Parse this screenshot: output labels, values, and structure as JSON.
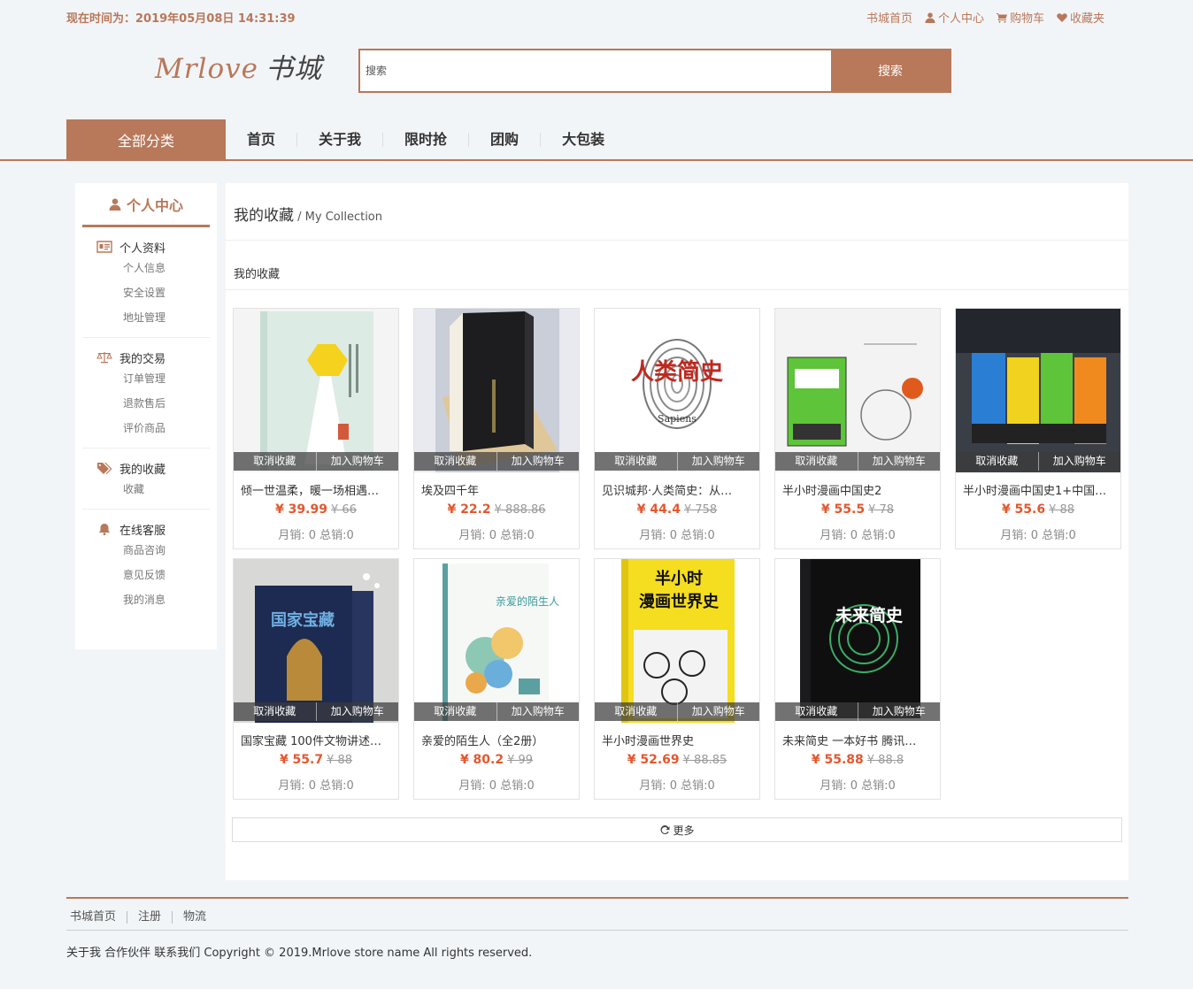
{
  "topbar": {
    "time_label": "现在时间为：2019年05月08日 14:31:39",
    "links": [
      {
        "label": "书城首页",
        "icon": "none"
      },
      {
        "label": "个人中心",
        "icon": "user-icon"
      },
      {
        "label": "购物车",
        "icon": "cart-icon"
      },
      {
        "label": "收藏夹",
        "icon": "heart-icon"
      }
    ]
  },
  "header": {
    "logo_en": "Mrlove",
    "logo_cn": "书城",
    "search_placeholder": "搜索",
    "search_button": "搜索"
  },
  "nav": {
    "all_categories": "全部分类",
    "items": [
      "首页",
      "关于我",
      "限时抢",
      "团购",
      "大包装"
    ]
  },
  "sidebar": {
    "title": "个人中心",
    "groups": [
      {
        "title": "个人资料",
        "icon": "profile-card-icon",
        "items": [
          "个人信息",
          "安全设置",
          "地址管理"
        ]
      },
      {
        "title": "我的交易",
        "icon": "scale-icon",
        "items": [
          "订单管理",
          "退款售后",
          "评价商品"
        ]
      },
      {
        "title": "我的收藏",
        "icon": "tag-icon",
        "items": [
          "收藏"
        ]
      },
      {
        "title": "在线客服",
        "icon": "bell-icon",
        "items": [
          "商品咨询",
          "意见反馈",
          "我的消息"
        ]
      }
    ]
  },
  "main": {
    "title": "我的收藏",
    "title_sep": " / ",
    "title_en": "My Collection",
    "subtitle": "我的收藏",
    "action_remove": "取消收藏",
    "action_cart": "加入购物车",
    "books": [
      {
        "name": "倾一世温柔，暖一场相遇…",
        "price": "¥ 39.99",
        "old_price": "¥ 66",
        "sales": "月销: 0 总销:0"
      },
      {
        "name": "埃及四千年",
        "price": "¥ 22.2",
        "old_price": "¥ 888.86",
        "sales": "月销: 0 总销:0"
      },
      {
        "name": "见识城邦·人类简史：从…",
        "price": "¥ 44.4",
        "old_price": "¥ 758",
        "sales": "月销: 0 总销:0"
      },
      {
        "name": "半小时漫画中国史2",
        "price": "¥ 55.5",
        "old_price": "¥ 78",
        "sales": "月销: 0 总销:0"
      },
      {
        "name": "半小时漫画中国史1+中国…",
        "price": "¥ 55.6",
        "old_price": "¥ 88",
        "sales": "月销: 0 总销:0"
      },
      {
        "name": "国家宝藏 100件文物讲述…",
        "price": "¥ 55.7",
        "old_price": "¥ 88",
        "sales": "月销: 0 总销:0"
      },
      {
        "name": "亲爱的陌生人（全2册）",
        "price": "¥ 80.2",
        "old_price": "¥ 99",
        "sales": "月销: 0 总销:0"
      },
      {
        "name": "半小时漫画世界史",
        "price": "¥ 52.69",
        "old_price": "¥ 88.85",
        "sales": "月销: 0 总销:0"
      },
      {
        "name": "未来简史 一本好书 腾讯…",
        "price": "¥ 55.88",
        "old_price": "¥ 88.8",
        "sales": "月销: 0 总销:0"
      }
    ],
    "cover_text": {
      "b3_title": "人类简史",
      "b3_sub": "Sapiens",
      "b8_title_1": "半小时",
      "b8_title_2": "漫画世界史",
      "b6_title": "国家宝藏",
      "b9_title": "未来简史",
      "b7_title": "亲爱的陌生人"
    },
    "more_label": "更多"
  },
  "footer": {
    "links": [
      "书城首页",
      "注册",
      "物流"
    ],
    "copyright": "关于我 合作伙伴 联系我们 Copyright © 2019.Mrlove store name All rights reserved."
  },
  "colors": {
    "accent": "#b8785a",
    "price": "#e4572e",
    "background": "#f2f5f8"
  }
}
